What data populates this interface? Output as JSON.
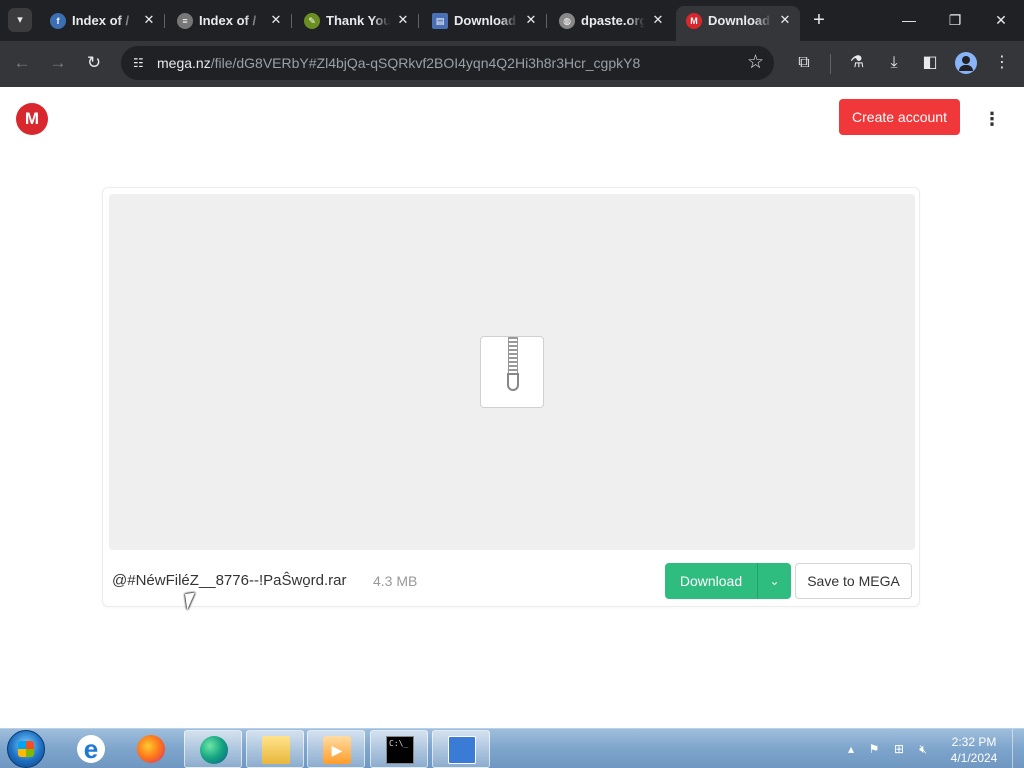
{
  "browser": {
    "tabs": [
      {
        "title": "Index of /",
        "favicon": "fedora-icon",
        "favicon_color": "#3c6eb4",
        "active": false
      },
      {
        "title": "Index of /",
        "favicon": "stack-icon",
        "favicon_color": "#777777",
        "active": false
      },
      {
        "title": "Thank You",
        "favicon": "pen-icon",
        "favicon_color": "#6b8e23",
        "active": false
      },
      {
        "title": "Download",
        "favicon": "document-icon",
        "favicon_color": "#4a6fb5",
        "active": false
      },
      {
        "title": "dpaste.org",
        "favicon": "globe-icon",
        "favicon_color": "#888888",
        "active": false
      },
      {
        "title": "Download",
        "favicon": "mega-icon",
        "favicon_color": "#d9272e",
        "active": true
      }
    ],
    "address": {
      "host": "mega.nz",
      "path": "/file/dG8VERbY#Zl4bjQa-qSQRkvf2BOI4yqn4Q2Hi3h8r3Hcr_cgpkY8"
    }
  },
  "page": {
    "logo_letter": "M",
    "create_account_label": "Create account",
    "file": {
      "name": "@#NéwFiléZ__8776--!PaŜwo̱rd.rar",
      "size": "4.3 MB"
    },
    "download_label": "Download",
    "save_label": "Save to MEGA"
  },
  "taskbar": {
    "time": "2:32 PM",
    "date": "4/1/2024"
  },
  "colors": {
    "mega_red": "#d9272e",
    "create_account": "#f0373a",
    "download_green": "#2ebd7f"
  }
}
